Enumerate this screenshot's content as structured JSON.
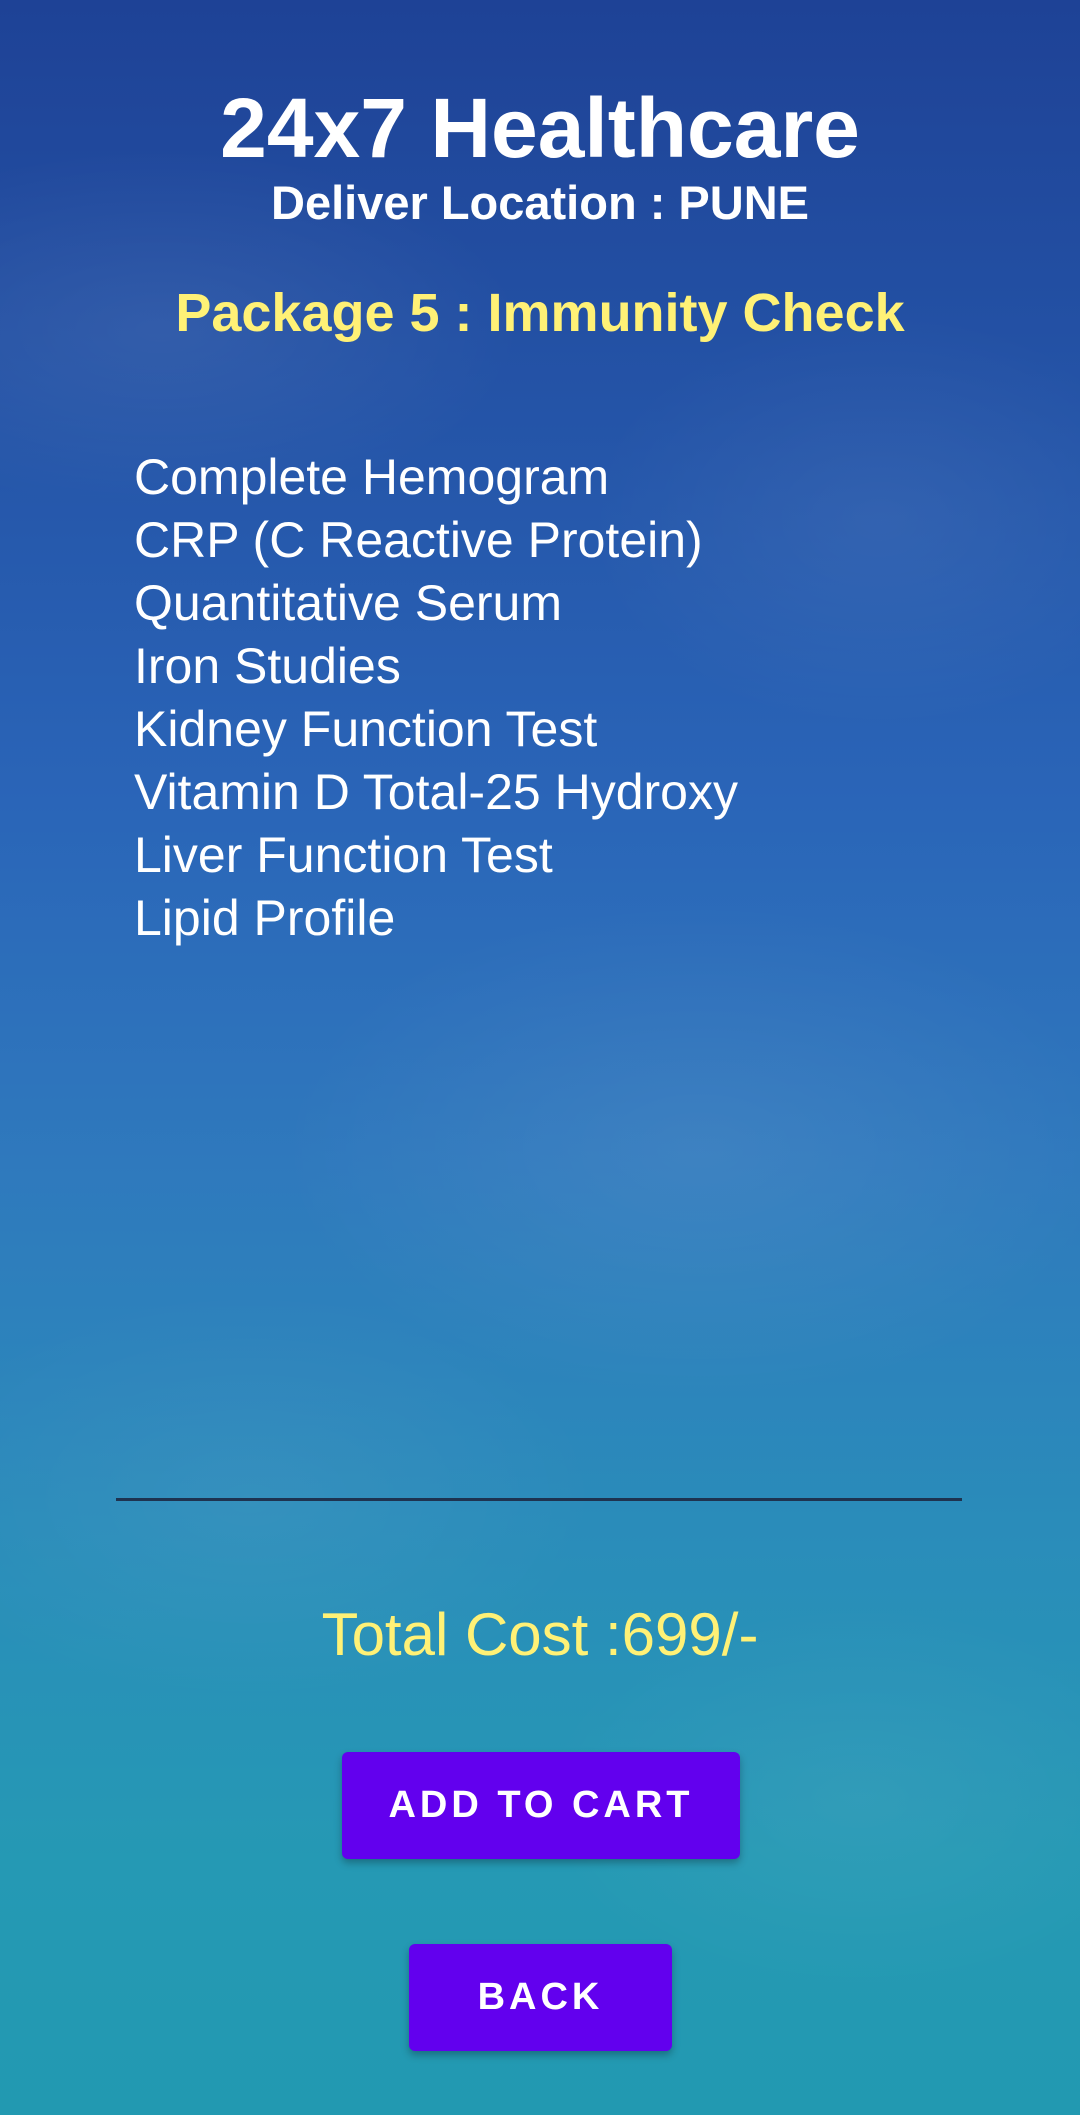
{
  "header": {
    "app_title": "24x7 Healthcare",
    "delivery_location": "Deliver Location : PUNE"
  },
  "package": {
    "title": "Package 5 : Immunity Check",
    "tests": [
      "Complete Hemogram",
      "CRP (C Reactive Protein)",
      "Quantitative Serum",
      "Iron Studies",
      "Kidney Function Test",
      "Vitamin D Total-25 Hydroxy",
      "Liver Function Test",
      "Lipid Profile"
    ]
  },
  "pricing": {
    "total_cost": "Total Cost :699/-"
  },
  "actions": {
    "add_to_cart_label": "ADD TO CART",
    "back_label": "BACK"
  },
  "colors": {
    "accent_button": "#6200ee",
    "highlight_text": "#fff176"
  }
}
